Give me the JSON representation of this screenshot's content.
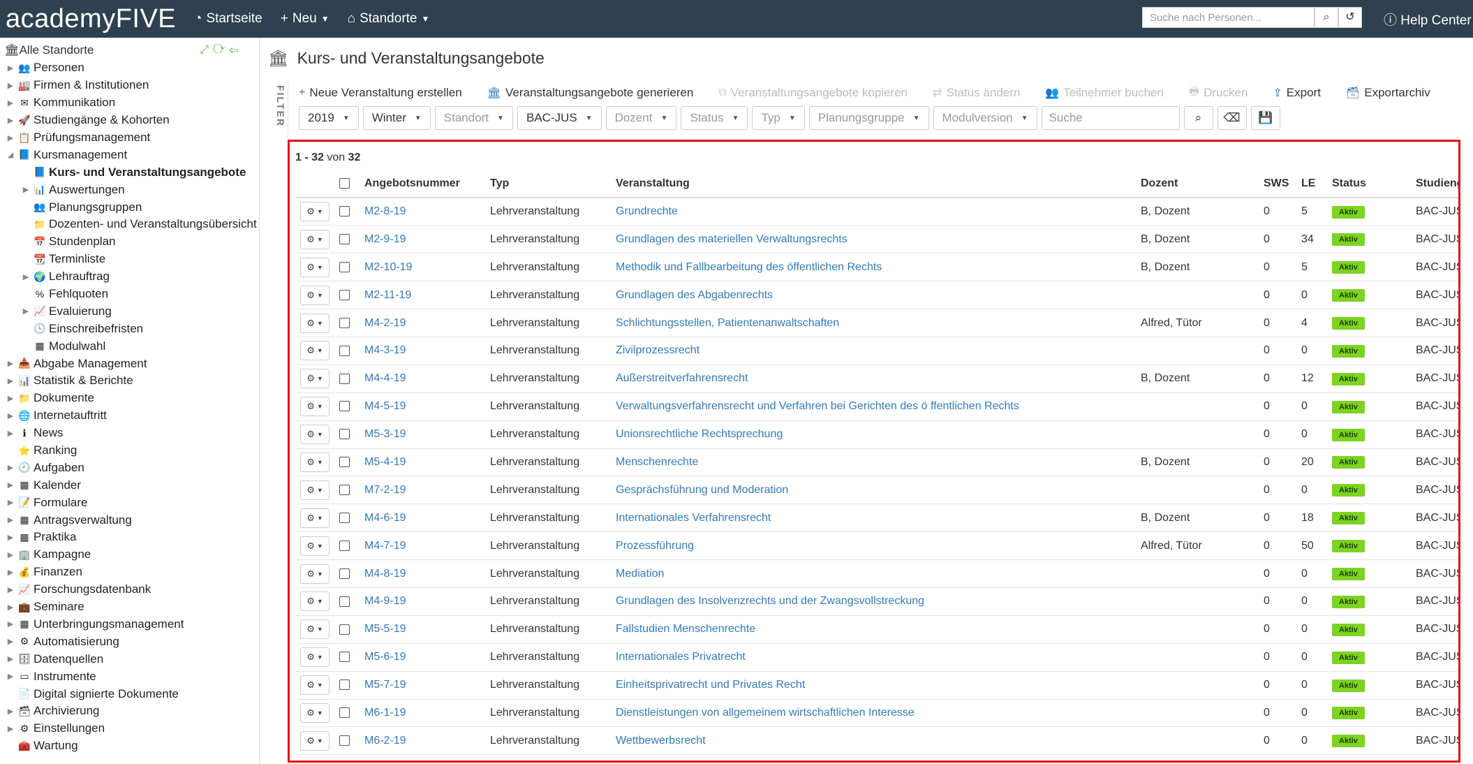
{
  "topbar": {
    "logo": "academyFIVE",
    "startseite": "Startseite",
    "neu": "Neu",
    "standorte": "Standorte",
    "search_placeholder": "Suche nach Personen...",
    "help": "Help Center"
  },
  "sidebar": {
    "root": "Alle Standorte",
    "items": [
      {
        "label": "Personen",
        "level": 0,
        "arrow": "▶",
        "icon": "users-icon",
        "glyph": "👥",
        "active": false
      },
      {
        "label": "Firmen & Institutionen",
        "level": 0,
        "arrow": "▶",
        "icon": "building-icon",
        "glyph": "🏭",
        "active": false
      },
      {
        "label": "Kommunikation",
        "level": 0,
        "arrow": "▶",
        "icon": "envelope-icon",
        "glyph": "✉",
        "active": false
      },
      {
        "label": "Studiengänge & Kohorten",
        "level": 0,
        "arrow": "▶",
        "icon": "rocket-icon",
        "glyph": "🚀",
        "active": false
      },
      {
        "label": "Prüfungsmanagement",
        "level": 0,
        "arrow": "▶",
        "icon": "exam-icon",
        "glyph": "📋",
        "active": false
      },
      {
        "label": "Kursmanagement",
        "level": 0,
        "arrow": "◢",
        "icon": "courses-icon",
        "glyph": "📘",
        "active": false
      },
      {
        "label": "Kurs- und Veranstaltungsangebote",
        "level": 1,
        "arrow": "",
        "icon": "book-icon",
        "glyph": "📘",
        "active": true
      },
      {
        "label": "Auswertungen",
        "level": 1,
        "arrow": "▶",
        "icon": "bar-chart-icon",
        "glyph": "📊",
        "active": false
      },
      {
        "label": "Planungsgruppen",
        "level": 1,
        "arrow": "",
        "icon": "group-icon",
        "glyph": "👥",
        "active": false
      },
      {
        "label": "Dozenten- und Veranstaltungsübersicht",
        "level": 1,
        "arrow": "",
        "icon": "folder-icon",
        "glyph": "📁",
        "active": false
      },
      {
        "label": "Stundenplan",
        "level": 1,
        "arrow": "",
        "icon": "calendar-icon",
        "glyph": "📅",
        "active": false
      },
      {
        "label": "Terminliste",
        "level": 1,
        "arrow": "",
        "icon": "calendar-list-icon",
        "glyph": "📆",
        "active": false
      },
      {
        "label": "Lehrauftrag",
        "level": 1,
        "arrow": "▶",
        "icon": "globe-icon",
        "glyph": "🌍",
        "active": false
      },
      {
        "label": "Fehlquoten",
        "level": 1,
        "arrow": "",
        "icon": "percent-icon",
        "glyph": "%",
        "active": false
      },
      {
        "label": "Evaluierung",
        "level": 1,
        "arrow": "▶",
        "icon": "line-chart-icon",
        "glyph": "📈",
        "active": false
      },
      {
        "label": "Einschreibefristen",
        "level": 1,
        "arrow": "",
        "icon": "clock-icon",
        "glyph": "🕓",
        "active": false
      },
      {
        "label": "Modulwahl",
        "level": 1,
        "arrow": "",
        "icon": "modules-icon",
        "glyph": "▦",
        "active": false
      },
      {
        "label": "Abgabe Management",
        "level": 0,
        "arrow": "▶",
        "icon": "submission-icon",
        "glyph": "📥",
        "active": false
      },
      {
        "label": "Statistik & Berichte",
        "level": 0,
        "arrow": "▶",
        "icon": "stats-icon",
        "glyph": "📊",
        "active": false
      },
      {
        "label": "Dokumente",
        "level": 0,
        "arrow": "▶",
        "icon": "documents-folder-icon",
        "glyph": "📁",
        "active": false
      },
      {
        "label": "Internetauftritt",
        "level": 0,
        "arrow": "▶",
        "icon": "globe-icon",
        "glyph": "🌐",
        "active": false
      },
      {
        "label": "News",
        "level": 0,
        "arrow": "▶",
        "icon": "info-icon",
        "glyph": "ℹ",
        "active": false
      },
      {
        "label": "Ranking",
        "level": 0,
        "arrow": "",
        "icon": "star-icon",
        "glyph": "⭐",
        "active": false
      },
      {
        "label": "Aufgaben",
        "level": 0,
        "arrow": "▶",
        "icon": "tasks-icon",
        "glyph": "🕘",
        "active": false
      },
      {
        "label": "Kalender",
        "level": 0,
        "arrow": "▶",
        "icon": "calendar-icon",
        "glyph": "▦",
        "active": false
      },
      {
        "label": "Formulare",
        "level": 0,
        "arrow": "▶",
        "icon": "forms-icon",
        "glyph": "📝",
        "active": false
      },
      {
        "label": "Antragsverwaltung",
        "level": 0,
        "arrow": "▶",
        "icon": "requests-icon",
        "glyph": "▦",
        "active": false
      },
      {
        "label": "Praktika",
        "level": 0,
        "arrow": "▶",
        "icon": "internship-icon",
        "glyph": "▦",
        "active": false
      },
      {
        "label": "Kampagne",
        "level": 0,
        "arrow": "▶",
        "icon": "campaign-icon",
        "glyph": "🏢",
        "active": false
      },
      {
        "label": "Finanzen",
        "level": 0,
        "arrow": "▶",
        "icon": "finance-icon",
        "glyph": "💰",
        "active": false
      },
      {
        "label": "Forschungsdatenbank",
        "level": 0,
        "arrow": "▶",
        "icon": "research-icon",
        "glyph": "📈",
        "active": false
      },
      {
        "label": "Seminare",
        "level": 0,
        "arrow": "▶",
        "icon": "seminar-icon",
        "glyph": "💼",
        "active": false
      },
      {
        "label": "Unterbringungsmanagement",
        "level": 0,
        "arrow": "▶",
        "icon": "housing-icon",
        "glyph": "▦",
        "active": false
      },
      {
        "label": "Automatisierung",
        "level": 0,
        "arrow": "▶",
        "icon": "gear-icon",
        "glyph": "⚙",
        "active": false
      },
      {
        "label": "Datenquellen",
        "level": 0,
        "arrow": "▶",
        "icon": "database-icon",
        "glyph": "🗄",
        "active": false
      },
      {
        "label": "Instrumente",
        "level": 0,
        "arrow": "▶",
        "icon": "instruments-icon",
        "glyph": "▭",
        "active": false
      },
      {
        "label": "Digital signierte Dokumente",
        "level": 0,
        "arrow": "",
        "icon": "signed-document-icon",
        "glyph": "📄",
        "active": false
      },
      {
        "label": "Archivierung",
        "level": 0,
        "arrow": "▶",
        "icon": "archive-icon",
        "glyph": "🗃",
        "active": false
      },
      {
        "label": "Einstellungen",
        "level": 0,
        "arrow": "▶",
        "icon": "settings-icon",
        "glyph": "⚙",
        "active": false
      },
      {
        "label": "Wartung",
        "level": 0,
        "arrow": "",
        "icon": "maintenance-icon",
        "glyph": "🧰",
        "active": false
      }
    ]
  },
  "main": {
    "title": "Kurs- und Veranstaltungsangebote",
    "filter_tab": "FILTER",
    "actions": [
      {
        "label": "Neue Veranstaltung erstellen",
        "icon": "plus-icon",
        "glyph": "+",
        "disabled": false
      },
      {
        "label": "Veranstaltungsangebote generieren",
        "icon": "institution-icon",
        "glyph": "🏛",
        "disabled": false
      },
      {
        "label": "Veranstaltungsangebote kopieren",
        "icon": "copy-icon",
        "glyph": "⧉",
        "disabled": true
      },
      {
        "label": "Status ändern",
        "icon": "exchange-icon",
        "glyph": "⇄",
        "disabled": true
      },
      {
        "label": "Teilnehmer buchen",
        "icon": "participants-icon",
        "glyph": "👥",
        "disabled": true
      },
      {
        "label": "Drucken",
        "icon": "print-icon",
        "glyph": "🖶",
        "disabled": true
      },
      {
        "label": "Export",
        "icon": "export-icon",
        "glyph": "⇪",
        "disabled": false
      },
      {
        "label": "Exportarchiv",
        "icon": "archive-box-icon",
        "glyph": "🗃",
        "disabled": false
      }
    ],
    "filters": [
      {
        "label": "2019",
        "placeholder": false
      },
      {
        "label": "Winter",
        "placeholder": false
      },
      {
        "label": "Standort",
        "placeholder": true
      },
      {
        "label": "BAC-JUS",
        "placeholder": false
      },
      {
        "label": "Dozent",
        "placeholder": true
      },
      {
        "label": "Status",
        "placeholder": true
      },
      {
        "label": "Typ",
        "placeholder": true
      },
      {
        "label": "Planungsgruppe",
        "placeholder": true
      },
      {
        "label": "Modulversion",
        "placeholder": true
      }
    ],
    "search_placeholder": "Suche",
    "count": {
      "from": "1",
      "sep": "-",
      "to": "32",
      "von": "von",
      "total": "32"
    },
    "columns": [
      "Angebotsnummer",
      "Typ",
      "Veranstaltung",
      "Dozent",
      "SWS",
      "LE",
      "Status",
      "Studiengang"
    ],
    "rows": [
      {
        "nr": "M2-8-19",
        "typ": "Lehrveranstaltung",
        "veranstaltung": "Grundrechte",
        "dozent": "B, Dozent",
        "sws": "0",
        "le": "5",
        "status": "Aktiv",
        "studiengang": "BAC-JUS"
      },
      {
        "nr": "M2-9-19",
        "typ": "Lehrveranstaltung",
        "veranstaltung": "Grundlagen des materiellen Verwaltungsrechts",
        "dozent": "B, Dozent",
        "sws": "0",
        "le": "34",
        "status": "Aktiv",
        "studiengang": "BAC-JUS"
      },
      {
        "nr": "M2-10-19",
        "typ": "Lehrveranstaltung",
        "veranstaltung": "Methodik und Fallbearbeitung des öffentlichen Rechts",
        "dozent": "B, Dozent",
        "sws": "0",
        "le": "5",
        "status": "Aktiv",
        "studiengang": "BAC-JUS"
      },
      {
        "nr": "M2-11-19",
        "typ": "Lehrveranstaltung",
        "veranstaltung": "Grundlagen des Abgabenrechts",
        "dozent": "",
        "sws": "0",
        "le": "0",
        "status": "Aktiv",
        "studiengang": "BAC-JUS"
      },
      {
        "nr": "M4-2-19",
        "typ": "Lehrveranstaltung",
        "veranstaltung": "Schlichtungsstellen, Patientenanwaltschaften",
        "dozent": "Alfred, Tütor",
        "sws": "0",
        "le": "4",
        "status": "Aktiv",
        "studiengang": "BAC-JUS"
      },
      {
        "nr": "M4-3-19",
        "typ": "Lehrveranstaltung",
        "veranstaltung": "Zivilprozessrecht",
        "dozent": "",
        "sws": "0",
        "le": "0",
        "status": "Aktiv",
        "studiengang": "BAC-JUS"
      },
      {
        "nr": "M4-4-19",
        "typ": "Lehrveranstaltung",
        "veranstaltung": "Außerstreitverfahrensrecht",
        "dozent": "B, Dozent",
        "sws": "0",
        "le": "12",
        "status": "Aktiv",
        "studiengang": "BAC-JUS"
      },
      {
        "nr": "M4-5-19",
        "typ": "Lehrveranstaltung",
        "veranstaltung": "Verwaltungsverfahrensrecht und Verfahren bei Gerichten des ö ffentlichen Rechts",
        "dozent": "",
        "sws": "0",
        "le": "0",
        "status": "Aktiv",
        "studiengang": "BAC-JUS"
      },
      {
        "nr": "M5-3-19",
        "typ": "Lehrveranstaltung",
        "veranstaltung": "Unionsrechtliche Rechtsprechung",
        "dozent": "",
        "sws": "0",
        "le": "0",
        "status": "Aktiv",
        "studiengang": "BAC-JUS"
      },
      {
        "nr": "M5-4-19",
        "typ": "Lehrveranstaltung",
        "veranstaltung": "Menschenrechte",
        "dozent": "B, Dozent",
        "sws": "0",
        "le": "20",
        "status": "Aktiv",
        "studiengang": "BAC-JUS"
      },
      {
        "nr": "M7-2-19",
        "typ": "Lehrveranstaltung",
        "veranstaltung": "Gesprächsführung und Moderation",
        "dozent": "",
        "sws": "0",
        "le": "0",
        "status": "Aktiv",
        "studiengang": "BAC-JUS"
      },
      {
        "nr": "M4-6-19",
        "typ": "Lehrveranstaltung",
        "veranstaltung": "Internationales Verfahrensrecht",
        "dozent": "B, Dozent",
        "sws": "0",
        "le": "18",
        "status": "Aktiv",
        "studiengang": "BAC-JUS"
      },
      {
        "nr": "M4-7-19",
        "typ": "Lehrveranstaltung",
        "veranstaltung": "Prozessführung",
        "dozent": "Alfred, Tütor",
        "sws": "0",
        "le": "50",
        "status": "Aktiv",
        "studiengang": "BAC-JUS"
      },
      {
        "nr": "M4-8-19",
        "typ": "Lehrveranstaltung",
        "veranstaltung": "Mediation",
        "dozent": "",
        "sws": "0",
        "le": "0",
        "status": "Aktiv",
        "studiengang": "BAC-JUS"
      },
      {
        "nr": "M4-9-19",
        "typ": "Lehrveranstaltung",
        "veranstaltung": "Grundlagen des Insolvenzrechts und der Zwangsvollstreckung",
        "dozent": "",
        "sws": "0",
        "le": "0",
        "status": "Aktiv",
        "studiengang": "BAC-JUS"
      },
      {
        "nr": "M5-5-19",
        "typ": "Lehrveranstaltung",
        "veranstaltung": "Fallstudien Menschenrechte",
        "dozent": "",
        "sws": "0",
        "le": "0",
        "status": "Aktiv",
        "studiengang": "BAC-JUS"
      },
      {
        "nr": "M5-6-19",
        "typ": "Lehrveranstaltung",
        "veranstaltung": "Internationales Privatrecht",
        "dozent": "",
        "sws": "0",
        "le": "0",
        "status": "Aktiv",
        "studiengang": "BAC-JUS"
      },
      {
        "nr": "M5-7-19",
        "typ": "Lehrveranstaltung",
        "veranstaltung": "Einheitsprivatrecht und Privates Recht",
        "dozent": "",
        "sws": "0",
        "le": "0",
        "status": "Aktiv",
        "studiengang": "BAC-JUS"
      },
      {
        "nr": "M6-1-19",
        "typ": "Lehrveranstaltung",
        "veranstaltung": "Dienstleistungen von allgemeinem wirtschaftlichen Interesse",
        "dozent": "",
        "sws": "0",
        "le": "0",
        "status": "Aktiv",
        "studiengang": "BAC-JUS"
      },
      {
        "nr": "M6-2-19",
        "typ": "Lehrveranstaltung",
        "veranstaltung": "Wettbewerbsrecht",
        "dozent": "",
        "sws": "0",
        "le": "0",
        "status": "Aktiv",
        "studiengang": "BAC-JUS"
      }
    ]
  },
  "colors": {
    "topbar": "#2f4050",
    "link": "#337ab7",
    "status_active": "#7cd321",
    "highlight_frame": "#e0101a"
  }
}
